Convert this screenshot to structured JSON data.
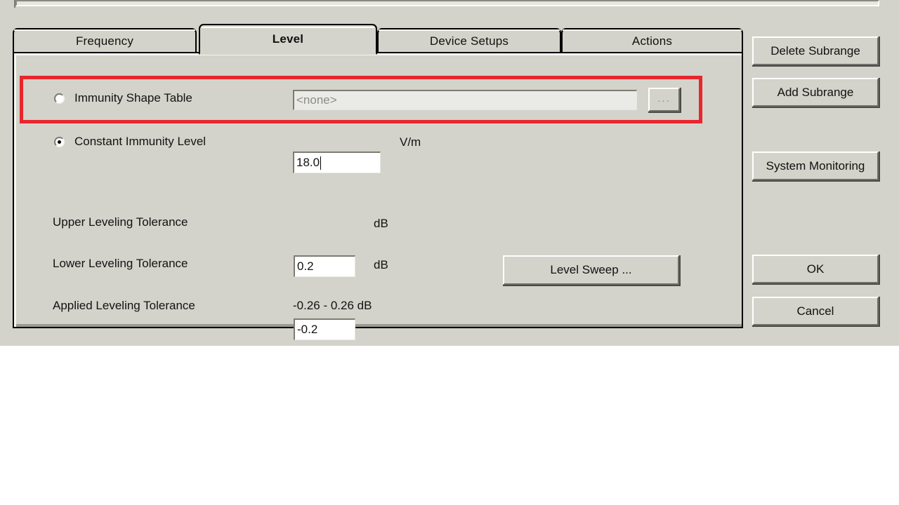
{
  "window": {
    "background_color": "#d3d3cb",
    "accent_highlight_color": "#e8262d"
  },
  "tabs": [
    {
      "id": "frequency",
      "label": "Frequency",
      "active": false
    },
    {
      "id": "level",
      "label": "Level",
      "active": true
    },
    {
      "id": "device-setups",
      "label": "Device Setups",
      "active": false
    },
    {
      "id": "actions",
      "label": "Actions",
      "active": false
    }
  ],
  "level_panel": {
    "immunity_shape_table": {
      "label": "Immunity Shape Table",
      "selected": false,
      "field_value": "<none>",
      "field_enabled": false,
      "browse_button_label": "...",
      "browse_button_enabled": false
    },
    "constant_immunity_level": {
      "label": "Constant Immunity Level",
      "selected": true,
      "field_value": "18.0",
      "unit": "V/m"
    },
    "upper_leveling_tolerance": {
      "label": "Upper Leveling Tolerance",
      "field_value": "0.2",
      "unit": "dB"
    },
    "lower_leveling_tolerance": {
      "label": "Lower Leveling Tolerance",
      "field_value": "-0.2",
      "unit": "dB"
    },
    "applied_leveling_tolerance": {
      "label": "Applied Leveling Tolerance",
      "value": "-0.26 - 0.26 dB"
    },
    "level_sweep_button": "Level Sweep ..."
  },
  "side_buttons": {
    "delete_subrange": "Delete Subrange",
    "add_subrange": "Add Subrange",
    "system_monitoring": "System Monitoring",
    "ok": "OK",
    "cancel": "Cancel"
  }
}
